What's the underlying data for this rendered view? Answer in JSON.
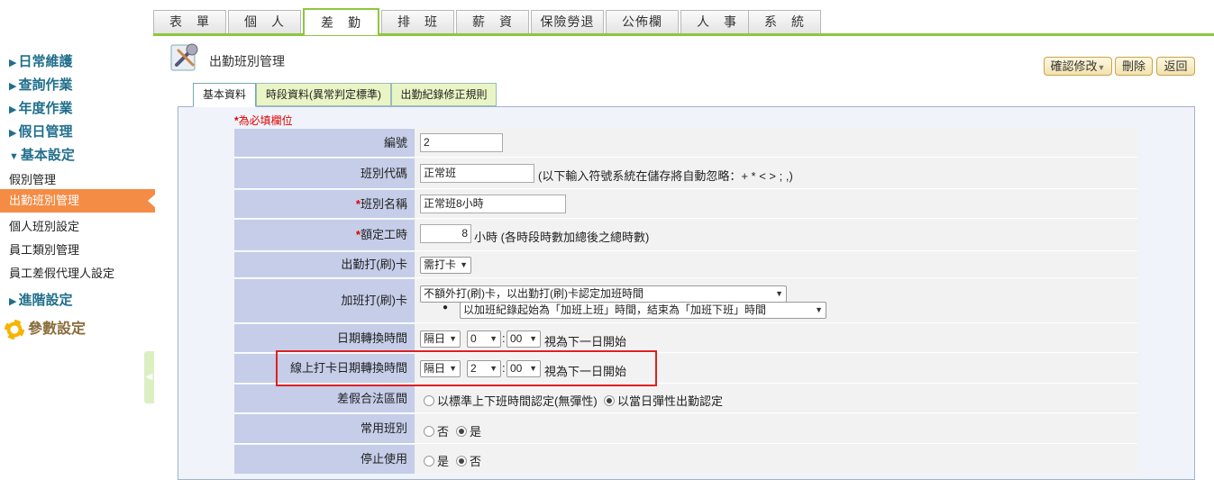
{
  "top_tabs": [
    {
      "label": "表　單"
    },
    {
      "label": "個　人"
    },
    {
      "label": "差　勤"
    },
    {
      "label": "排　班"
    },
    {
      "label": "薪　資"
    },
    {
      "label": "保險勞退"
    },
    {
      "label": "公佈欄"
    },
    {
      "label": "人　事"
    },
    {
      "label": "系　統"
    }
  ],
  "sidebar": {
    "daily": "日常維護",
    "query": "查詢作業",
    "annual": "年度作業",
    "holiday": "假日管理",
    "basic": "基本設定",
    "items": [
      "假別管理",
      "出勤班別管理",
      "個人班別設定",
      "員工類別管理",
      "員工差假代理人設定"
    ],
    "advanced": "進階設定",
    "params": "參數設定"
  },
  "page": {
    "title": "出勤班別管理",
    "confirm_label": "確認修改",
    "delete_label": "刪除",
    "back_label": "返回"
  },
  "sub_tabs": [
    "基本資料",
    "時段資料(異常判定標準)",
    "出勤紀錄修正規則"
  ],
  "required_note": "為必填欄位",
  "form": {
    "id_label": "編號",
    "id_value": "2",
    "code_label": "班別代碼",
    "code_value": "正常班",
    "code_hint": "(以下輸入符號系統在儲存將自動忽略：+ * < > ; ,)",
    "name_label": "班別名稱",
    "name_value": "正常班8小時",
    "hours_label": "額定工時",
    "hours_value": "8",
    "hours_unit": "小時 (各時段時數加總後之總時數)",
    "clock_label": "出勤打(刷)卡",
    "clock_value": "需打卡",
    "ot_label": "加班打(刷)卡",
    "ot_value": "不額外打(刷)卡，以出勤打(刷)卡認定加班時間",
    "ot_sub_value": "以加班紀錄起始為「加班上班」時間，結束為「加班下班」時間",
    "date_switch_label": "日期轉換時間",
    "date_switch_day": "隔日",
    "date_switch_hour": "0",
    "date_switch_min": "00",
    "date_switch_suffix": "視為下一日開始",
    "online_switch_label": "線上打卡日期轉換時間",
    "online_switch_day": "隔日",
    "online_switch_hour": "2",
    "online_switch_min": "00",
    "online_switch_suffix": "視為下一日開始",
    "leave_range_label": "差假合法區間",
    "leave_opt1": "以標準上下班時間認定(無彈性)",
    "leave_opt2": "以當日彈性出勤認定",
    "common_label": "常用班別",
    "common_no": "否",
    "common_yes": "是",
    "disable_label": "停止使用",
    "disable_yes": "是",
    "disable_no": "否",
    "colon": ":"
  },
  "colors": {
    "accent_green": "#8ec63f",
    "active_orange": "#f58c45",
    "label_blue": "#c5cde8",
    "highlight_red": "#e02020"
  }
}
